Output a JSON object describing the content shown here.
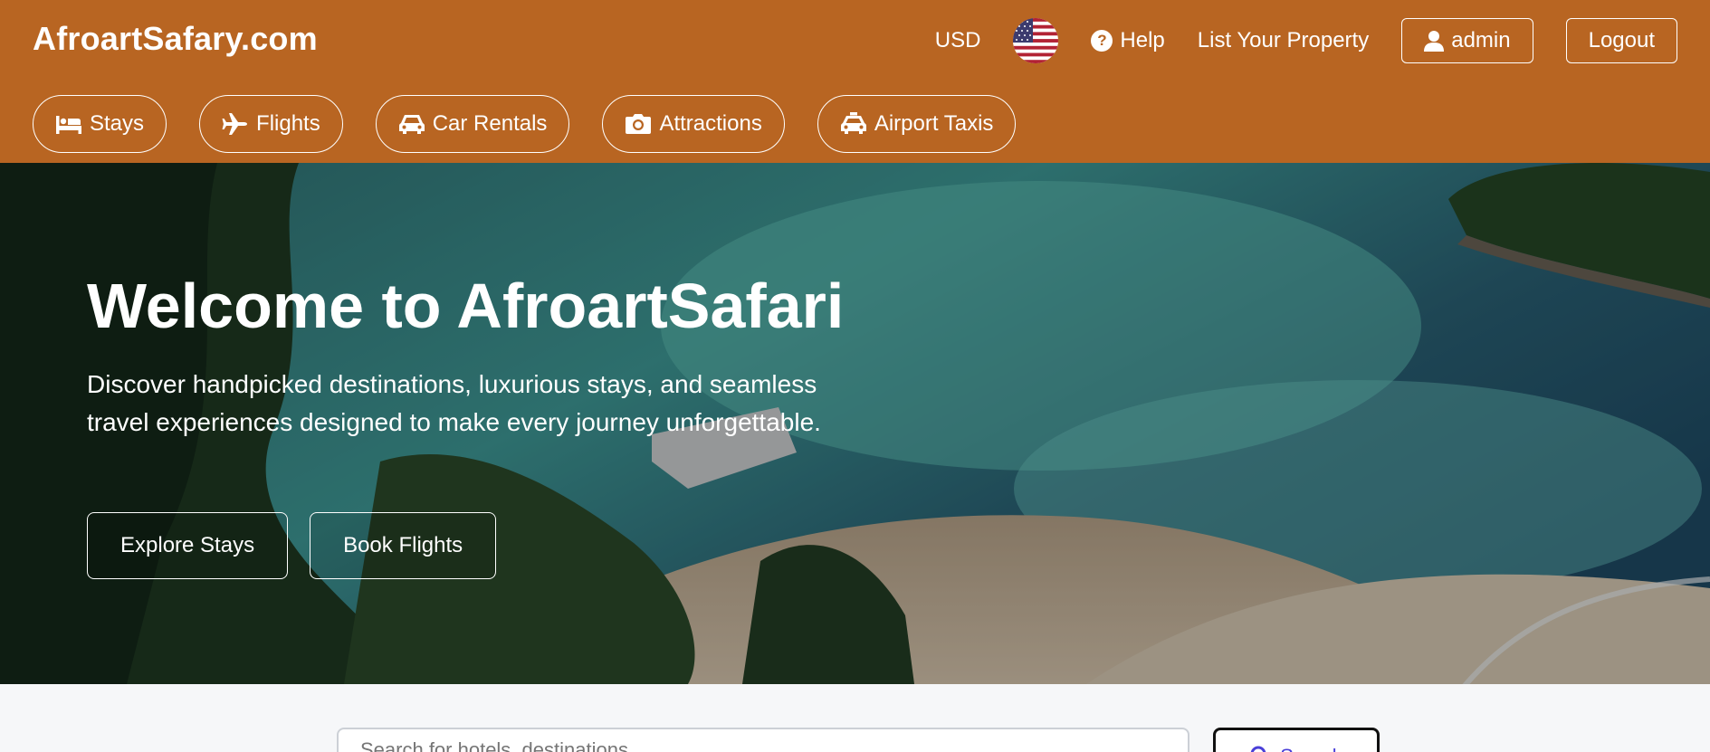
{
  "header": {
    "brand": "AfroartSafary.com",
    "currency": "USD",
    "flag_icon": "us-flag-icon",
    "help_label": "Help",
    "list_property_label": "List Your Property",
    "user_label": "admin",
    "logout_label": "Logout"
  },
  "tabs": [
    {
      "label": "Stays",
      "icon": "bed-icon"
    },
    {
      "label": "Flights",
      "icon": "plane-icon"
    },
    {
      "label": "Car Rentals",
      "icon": "car-icon"
    },
    {
      "label": "Attractions",
      "icon": "camera-icon"
    },
    {
      "label": "Airport Taxis",
      "icon": "taxi-icon"
    }
  ],
  "hero": {
    "title": "Welcome to AfroartSafari",
    "subtitle": "Discover handpicked destinations, luxurious stays, and seamless travel experiences designed to make every journey unforgettable.",
    "explore_label": "Explore Stays",
    "book_label": "Book Flights"
  },
  "search": {
    "placeholder": "Search for hotels, destinations...",
    "button_label": "Search"
  },
  "colors": {
    "brand": "#b86522",
    "search_accent": "#4a3fd8"
  }
}
